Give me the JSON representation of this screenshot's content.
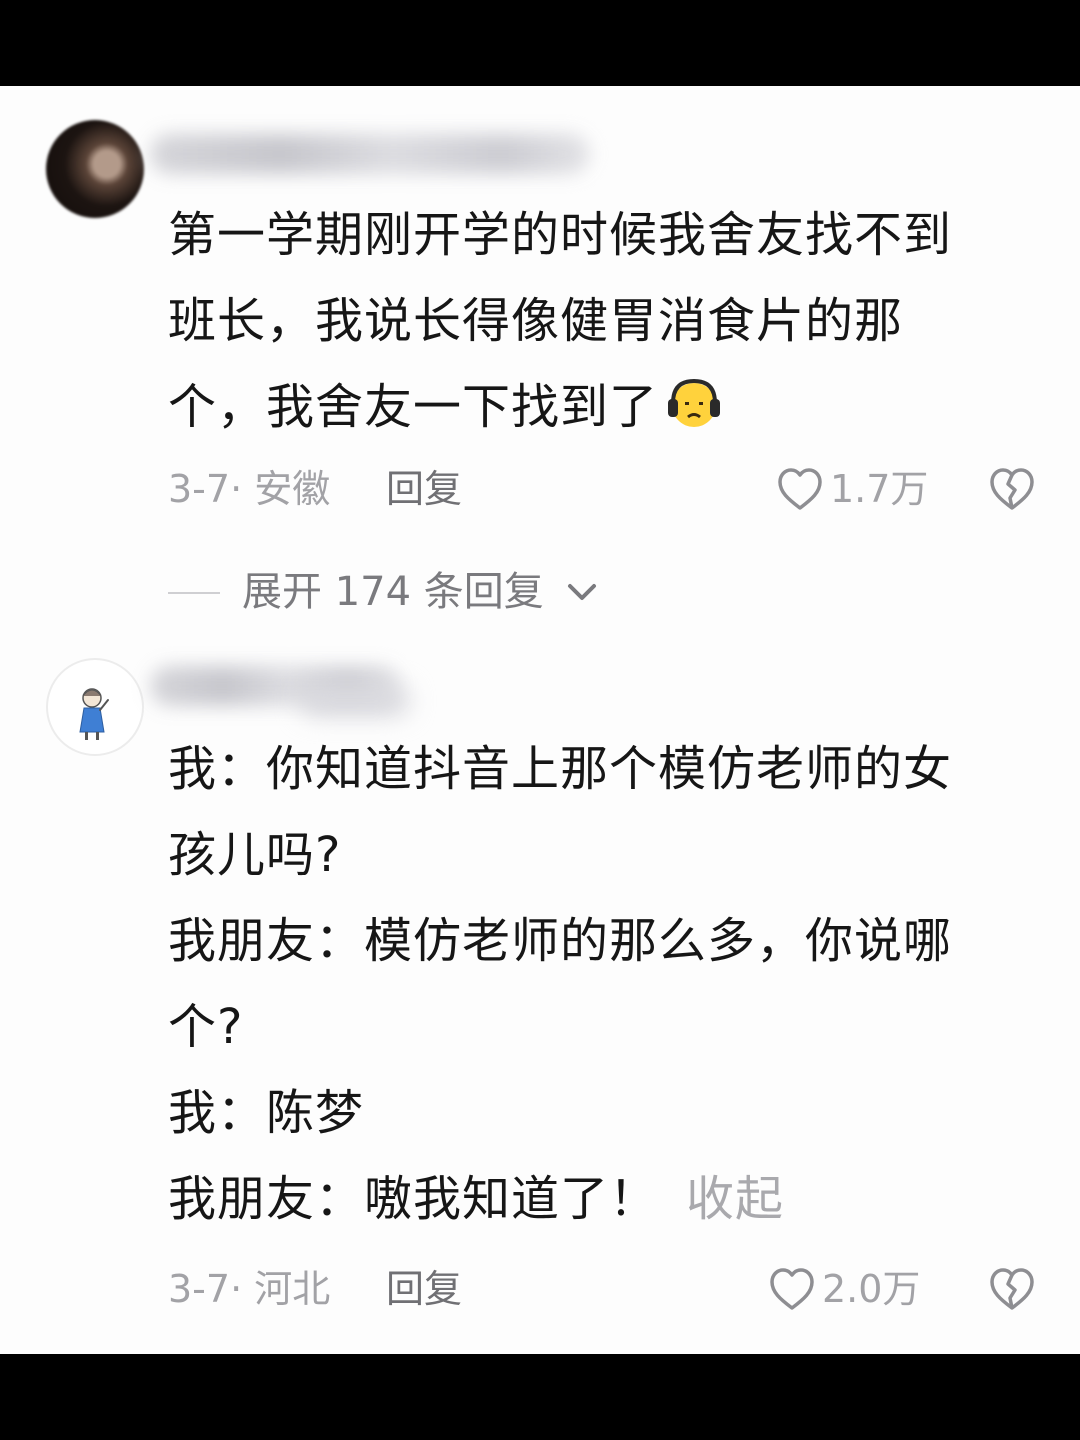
{
  "comments": [
    {
      "text_lines": [
        "第一学期刚开学的时候我舍友找不到",
        "班长，我说长得像健胃消食片的那",
        "个，我舍友一下找到了"
      ],
      "emoji": "headphones-face-emoji",
      "date_location": "3-7· 安徽",
      "reply_label": "回复",
      "like_count": "1.7万",
      "icons": {
        "like": "heart-outline-icon",
        "dislike": "broken-heart-icon"
      }
    },
    {
      "text_lines": [
        "我：你知道抖音上那个模仿老师的女",
        "孩儿吗?",
        "我朋友：模仿老师的那么多，你说哪",
        "个?",
        "我：陈梦",
        "我朋友：嗷我知道了！"
      ],
      "collapse_label": "收起",
      "date_location": "3-7· 河北",
      "reply_label": "回复",
      "like_count": "2.0万",
      "icons": {
        "like": "heart-outline-icon",
        "dislike": "broken-heart-icon"
      }
    }
  ],
  "expand_replies": {
    "label": "展开 174 条回复",
    "icon": "chevron-down-icon"
  },
  "colors": {
    "background": "#fdfdfd",
    "text_primary": "#161616",
    "text_secondary": "#a2a2a6",
    "reply_text": "#707074"
  }
}
